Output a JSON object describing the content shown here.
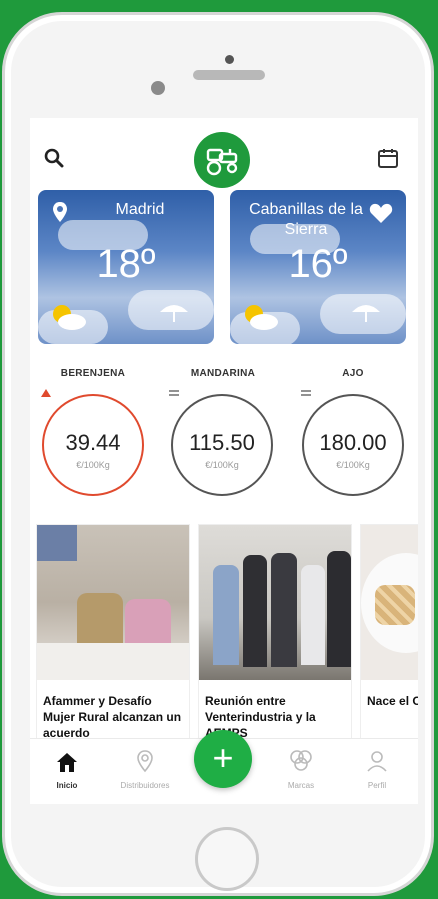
{
  "header": {
    "search_icon": "search-icon",
    "logo_icon": "tractor-icon",
    "calendar_icon": "calendar-icon"
  },
  "weather": [
    {
      "city": "Madrid",
      "temp": "18º",
      "icon": "sun-cloud-icon",
      "accent": "#f5c400"
    },
    {
      "city": "Cabanillas de la Sierra",
      "temp": "16º",
      "icon": "sun-cloud-icon",
      "favorite_icon": "heart-icon"
    }
  ],
  "prices": [
    {
      "name": "BERENJENA",
      "value": "39.44",
      "unit": "€/100Kg",
      "trend": "up",
      "trend_color": "#e04a2e"
    },
    {
      "name": "MANDARINA",
      "value": "115.50",
      "unit": "€/100Kg",
      "trend": "equal"
    },
    {
      "name": "AJO",
      "value": "180.00",
      "unit": "€/100Kg",
      "trend": "equal"
    }
  ],
  "news": [
    {
      "title": "Afammer y Desafío Mujer Rural alcanzan un acuerdo"
    },
    {
      "title": "Reunión entre Venterindustria y la AEMPS"
    },
    {
      "title": "Nace el Operativ"
    }
  ],
  "tabs": [
    {
      "label": "Inicio",
      "icon": "home-icon",
      "active": true
    },
    {
      "label": "Distribuidores",
      "icon": "map-pin-icon"
    },
    {
      "label": "Marcas",
      "icon": "brands-icon"
    },
    {
      "label": "Perfil",
      "icon": "profile-icon"
    }
  ],
  "fab": {
    "label": "+"
  },
  "colors": {
    "brand": "#1f9a3c",
    "fab": "#1fae45"
  }
}
